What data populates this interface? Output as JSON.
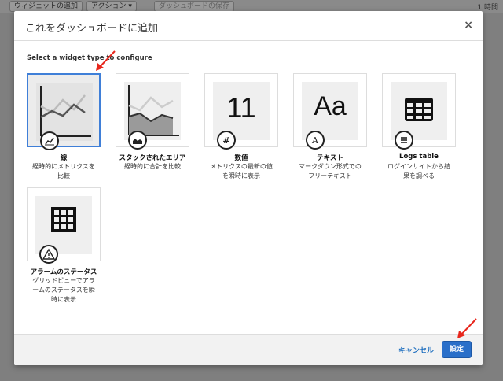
{
  "background_toolbar": {
    "buttons": [
      "ウィジェットの追加",
      "アクション ▾",
      "ダッシュボードの保存"
    ],
    "right_text": "1 時間"
  },
  "modal": {
    "title": "これをダッシュボードに追加",
    "close_symbol": "×",
    "section_label": "Select a widget type to configure",
    "widgets": [
      {
        "icon": "line-chart-icon",
        "title": "線",
        "desc_lines": [
          "経時的にメトリクスを",
          "比較"
        ],
        "selected": true
      },
      {
        "icon": "stacked-area-icon",
        "title": "スタックされたエリア",
        "desc_lines": [
          "経時的に合計を比較"
        ],
        "selected": false
      },
      {
        "icon": "number-icon",
        "preview": "11",
        "title": "数値",
        "desc_lines": [
          "メトリクスの最新の値",
          "を瞬時に表示"
        ],
        "selected": false
      },
      {
        "icon": "text-icon",
        "preview": "Aa",
        "title": "テキスト",
        "desc_lines": [
          "マークダウン形式での",
          "フリーテキスト"
        ],
        "selected": false
      },
      {
        "icon": "logs-table-icon",
        "title": "Logs table",
        "desc_lines": [
          "ログインサイトから結",
          "果を調べる"
        ],
        "selected": false
      },
      {
        "icon": "alarm-status-icon",
        "title": "アラームのステータス",
        "desc_lines": [
          "グリッドビューでアラ",
          "ームのステータスを瞬",
          "時に表示"
        ],
        "selected": false
      }
    ],
    "footer": {
      "cancel_label": "キャンセル",
      "save_label": "設定"
    }
  },
  "colors": {
    "accent": "#2a6fc9",
    "selected_border": "#3f7fd8",
    "annotation_arrow": "#e8261c"
  }
}
